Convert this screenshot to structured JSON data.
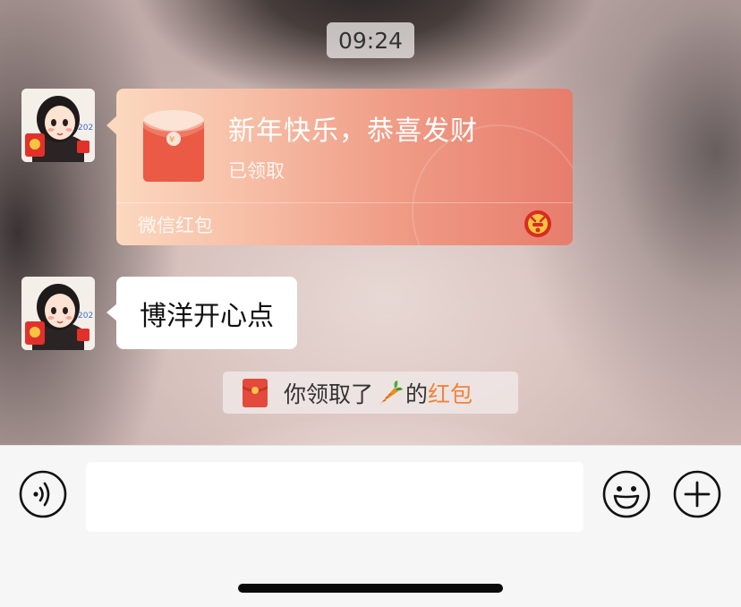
{
  "chat": {
    "timestamp": "09:24",
    "messages": [
      {
        "type": "red_packet",
        "sender": "other",
        "title": "新年快乐，恭喜发财",
        "status": "已领取",
        "brand": "微信红包",
        "icon": "red-envelope-icon",
        "badge_icon": "zodiac-badge-icon"
      },
      {
        "type": "text",
        "sender": "other",
        "text": "博洋开心点"
      },
      {
        "type": "system",
        "prefix": "你领取了",
        "emoji": "carrot-emoji",
        "middle": "的",
        "link": "红包"
      }
    ]
  },
  "input_bar": {
    "voice_icon": "voice-icon",
    "input_value": "",
    "emoji_icon": "smiley-icon",
    "plus_icon": "plus-icon"
  },
  "colors": {
    "red_packet_start": "#fbd8bf",
    "red_packet_end": "#e77d6c",
    "link_orange": "#f0833c",
    "input_bar_bg": "#f6f6f6"
  }
}
